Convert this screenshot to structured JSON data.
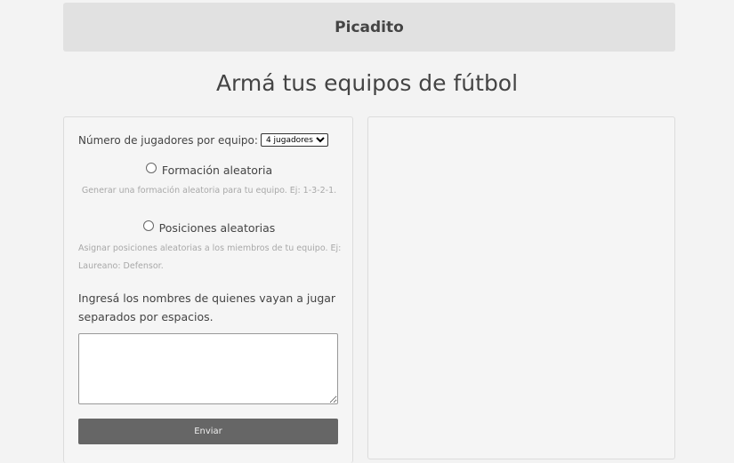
{
  "header": {
    "title": "Picadito"
  },
  "main": {
    "title": "Armá tus equipos de fútbol"
  },
  "form": {
    "players_label": "Número de jugadores por equipo:",
    "players_selected": "4 jugadores",
    "option_formation": {
      "label": "Formación aleatoria",
      "hint": "Generar una formación aleatoria para tu equipo. Ej: 1-3-2-1."
    },
    "option_positions": {
      "label": "Posiciones aleatorias",
      "hint_line1": "Asignar posiciones aleatorias a los miembros de tu equipo. Ej:",
      "hint_line2": "Laureano: Defensor."
    },
    "names_label": "Ingresá los nombres de quienes vayan a jugar separados por espacios.",
    "names_value": "",
    "submit_label": "Enviar"
  },
  "colors": {
    "background": "#f3f3f3",
    "header_bg": "#e1e1e1",
    "button_bg": "#666666",
    "hint_text": "#a8a8a8"
  }
}
